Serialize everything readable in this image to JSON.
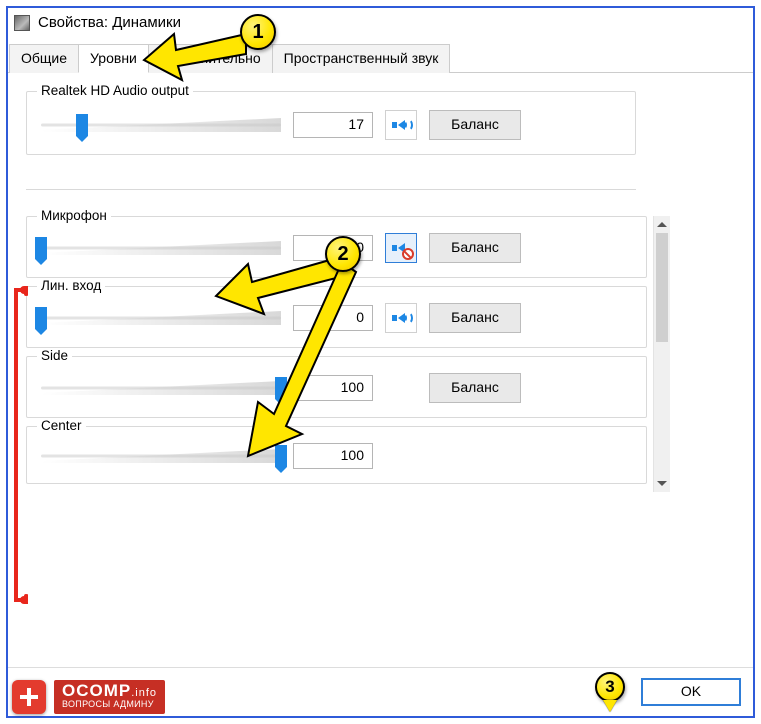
{
  "window": {
    "title": "Свойства: Динамики"
  },
  "tabs": [
    {
      "label": "Общие"
    },
    {
      "label": "Уровни"
    },
    {
      "label": "Дополнительно"
    },
    {
      "label": "Пространственный звук"
    }
  ],
  "active_tab_index": 1,
  "main_output": {
    "name": "Realtek HD Audio output",
    "value": "17",
    "percent": 17,
    "muted": false,
    "balance_label": "Баланс"
  },
  "inputs": [
    {
      "name": "Микрофон",
      "value": "0",
      "percent": 0,
      "muted": true,
      "balance_label": "Баланс",
      "show_mute": true,
      "show_balance": true
    },
    {
      "name": "Лин. вход",
      "value": "0",
      "percent": 0,
      "muted": false,
      "balance_label": "Баланс",
      "show_mute": true,
      "show_balance": true
    },
    {
      "name": "Side",
      "value": "100",
      "percent": 100,
      "muted": false,
      "balance_label": "Баланс",
      "show_mute": false,
      "show_balance": true
    },
    {
      "name": "Center",
      "value": "100",
      "percent": 100,
      "muted": false,
      "balance_label": "",
      "show_mute": false,
      "show_balance": false
    }
  ],
  "footer": {
    "ok": "OK"
  },
  "callouts": {
    "c1": "1",
    "c2": "2",
    "c3": "3"
  },
  "branding": {
    "name": "OCOMP",
    "tld": ".info",
    "tagline": "ВОПРОСЫ АДМИНУ"
  }
}
